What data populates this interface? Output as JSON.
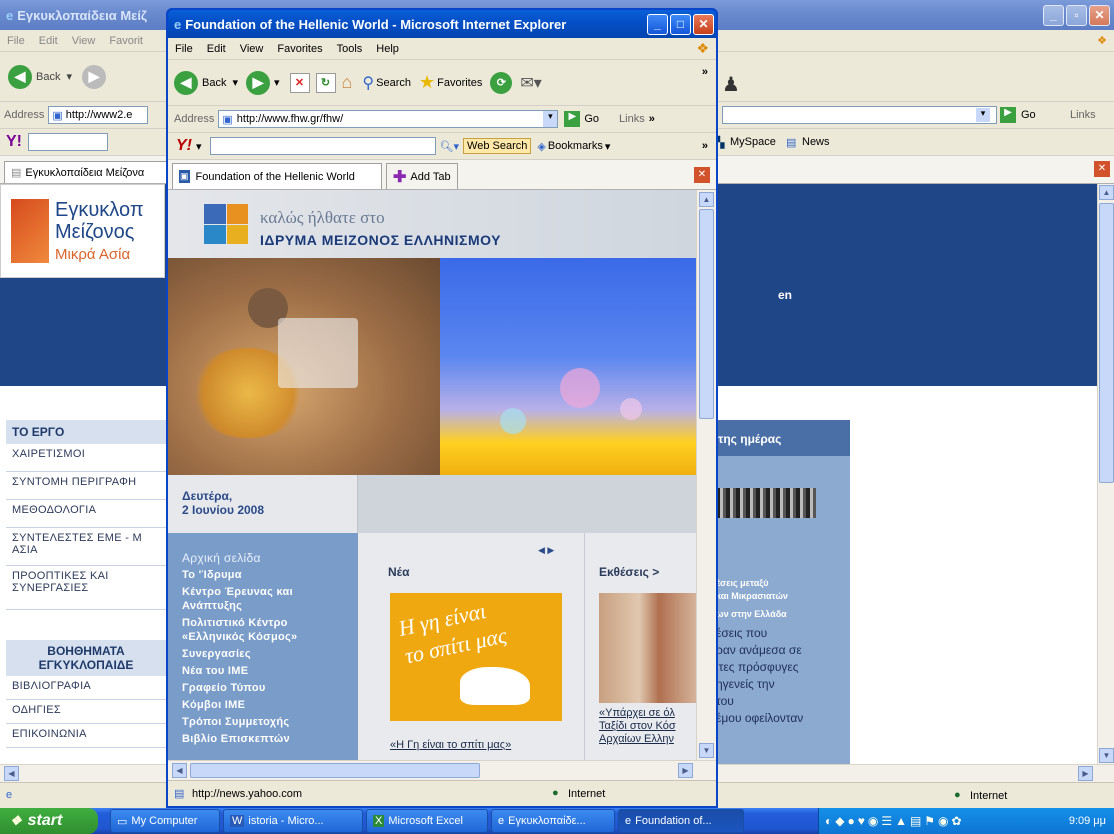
{
  "back_window": {
    "title": "Εγκυκλοπαίδεια Μείζ",
    "menu": [
      "File",
      "Edit",
      "View",
      "Favorit"
    ],
    "back_label": "Back",
    "address_label": "Address",
    "address_value": "http://www2.e",
    "go_label": "Go",
    "links_label": "Links",
    "tab_label": "Εγκυκλοπαίδεια Μείζονα",
    "myspace_label": "MySpace",
    "news_label": "News",
    "logo_line1": "Εγκυκλοπ",
    "logo_line2": "Μείζονος",
    "logo_line3": "Μικρά Ασία",
    "lang_link": "en",
    "sidebar_heading": "ΤΟ ΕΡΓΟ",
    "sidebar_items": [
      "ΧΑΙΡΕΤΙΣΜΟΙ",
      "ΣΥΝΤΟΜΗ ΠΕΡΙΓΡΑΦΗ",
      "ΜΕΘΟΔΟΛΟΓΙΑ",
      "ΣΥΝΤΕΛΕΣΤΕΣ ΕΜΕ - Μ ΑΣΙΑ",
      "ΠΡΟΟΠΤΙΚΕΣ ΚΑΙ ΣΥΝΕΡΓΑΣΙΕΣ"
    ],
    "aids_heading": "ΒΟΗΘΗΜΑΤΑ ΕΓΚΥΚΛΟΠΑΙΔΕ",
    "aids_items": [
      "ΒΙΒΛΙΟΓΡΑΦΙΑ",
      "ΟΔΗΓΙΕΣ",
      "ΕΠΙΚΟΙΝΩΝΙΑ"
    ],
    "day_box_title": "της ημέρας",
    "day_box_subtitle1": "έσεις μεταξύ",
    "day_box_subtitle2": "και Μικρασιατών",
    "day_box_subtitle3": "ων στην Ελλάδα",
    "day_box_text": [
      "έσεις που",
      "ραν ανάμεσα σε",
      "ιτες πρόσφυγες",
      "ηγενείς την",
      "του",
      "έμου οφείλονταν"
    ],
    "status_zone": "Internet"
  },
  "front_window": {
    "title": "Foundation of the Hellenic World - Microsoft Internet Explorer",
    "menu": [
      "File",
      "Edit",
      "View",
      "Favorites",
      "Tools",
      "Help"
    ],
    "back_label": "Back",
    "search_label": "Search",
    "favorites_label": "Favorites",
    "address_label": "Address",
    "address_value": "http://www.fhw.gr/fhw/",
    "go_label": "Go",
    "links_label": "Links",
    "web_search_label": "Web Search",
    "bookmarks_label": "Bookmarks",
    "tab_label": "Foundation of the Hellenic World",
    "add_tab_label": "Add Tab",
    "status_url": "http://news.yahoo.com",
    "status_zone": "Internet"
  },
  "fhw_page": {
    "welcome": "καλώς ήλθατε στο",
    "org_name": "ΙΔΡΥΜΑ ΜΕΙΖΟΝΟΣ ΕΛΛΗΝΙΣΜΟΥ",
    "date_line1": "Δευτέρα,",
    "date_line2": "2 Ιουνίου 2008",
    "menu_home": "Αρχική σελίδα",
    "menu_items": [
      "Το 'Ίδρυμα",
      "Κέντρο Έρευνας και Ανάπτυξης",
      "Πολιτιστικό Κέντρο «Ελληνικός Κόσμος»",
      "Συνεργασίες",
      "Νέα του ΙΜΕ",
      "Γραφείο Τύπου",
      "Κόμβοι ΙΜΕ",
      "Τρόποι Συμμετοχής",
      "Βιβλίο Επισκεπτών"
    ],
    "news_heading": "Νέα",
    "news_banner_line1": "Η γη είναι",
    "news_banner_line2": "το σπίτι μας",
    "news_link": "«Η Γη είναι το σπίτι μας»",
    "exhibitions_heading": "Εκθέσεις >",
    "exhibitions_link": [
      "«Υπάρχει σε όλ",
      "Ταξίδι στον Κόσ",
      "Αρχαίων Ελλην"
    ]
  },
  "taskbar": {
    "start_label": "start",
    "buttons": [
      "My Computer",
      "istoria - Micro...",
      "Microsoft Excel",
      "Εγκυκλοπαίδε...",
      "Foundation of..."
    ],
    "clock": "9:09 μμ"
  }
}
